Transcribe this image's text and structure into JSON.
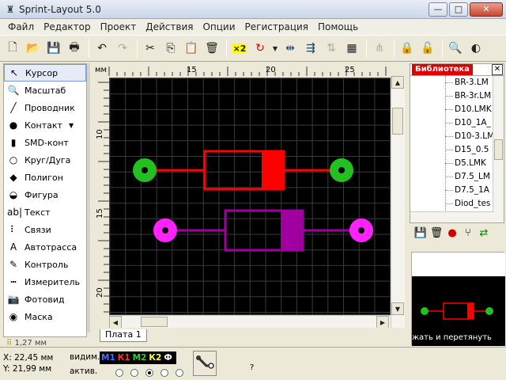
{
  "window": {
    "title": "Sprint-Layout 5.0",
    "min_label": "—",
    "max_label": "□",
    "close_label": "✕"
  },
  "menu": [
    "Файл",
    "Редактор",
    "Проект",
    "Действия",
    "Опции",
    "Регистрация",
    "Помощь"
  ],
  "toolbar": {
    "icons": [
      "new-icon",
      "open-icon",
      "save-icon",
      "print-icon",
      "undo-icon",
      "redo-icon",
      "cut-icon",
      "copy-icon",
      "paste-icon",
      "delete-icon",
      "x2-icon",
      "rotate-icon",
      "mirror-icon",
      "align-icon",
      "group-icon",
      "ungroup-icon",
      "connect-icon",
      "lock-icon",
      "unlock-icon",
      "zoom-icon",
      "contrast-icon"
    ],
    "x2_label": "×2"
  },
  "tools": [
    {
      "label": "Курсор",
      "icon": "cursor-icon",
      "glyph": "↖",
      "active": true
    },
    {
      "label": "Масштаб",
      "icon": "zoom-icon",
      "glyph": "🔍",
      "active": false
    },
    {
      "label": "Проводник",
      "icon": "track-icon",
      "glyph": "╱",
      "active": false
    },
    {
      "label": "Контакт",
      "icon": "pad-icon",
      "glyph": "●",
      "active": false,
      "dropdown": "▼"
    },
    {
      "label": "SMD-конт",
      "icon": "smd-icon",
      "glyph": "▮",
      "active": false
    },
    {
      "label": "Круг/Дуга",
      "icon": "circle-icon",
      "glyph": "○",
      "active": false
    },
    {
      "label": "Полигон",
      "icon": "polygon-icon",
      "glyph": "◆",
      "active": false
    },
    {
      "label": "Фигура",
      "icon": "shape-icon",
      "glyph": "◒",
      "active": false
    },
    {
      "label": "Текст",
      "icon": "text-icon",
      "glyph": "ab|",
      "active": false
    },
    {
      "label": "Связи",
      "icon": "connections-icon",
      "glyph": "⠇",
      "active": false
    },
    {
      "label": "Автотрасса",
      "icon": "autoroute-icon",
      "glyph": "A",
      "active": false
    },
    {
      "label": "Контроль",
      "icon": "check-icon",
      "glyph": "✎",
      "active": false
    },
    {
      "label": "Измеритель",
      "icon": "measure-icon",
      "glyph": "┅",
      "active": false
    },
    {
      "label": "Фотовид",
      "icon": "camera-icon",
      "glyph": "📷",
      "active": false
    },
    {
      "label": "Маска",
      "icon": "mask-icon",
      "glyph": "◉",
      "active": false
    }
  ],
  "grid_label": "1,27 мм",
  "ruler": {
    "unit": "мм",
    "top_ticks": [
      "15",
      "20",
      "25"
    ],
    "left_ticks": [
      "10",
      "15",
      "20"
    ]
  },
  "board_tab": "Плата 1",
  "library": {
    "title": "Библиотека",
    "close": "✕",
    "items": [
      "BR-3.LM",
      "BR-3r.LM",
      "D10.LMK",
      "D10_1A_",
      "D10-3.LM",
      "D15_0.5",
      "D5.LMK",
      "D7.5_LM",
      "D7.5_1A",
      "Diod_tes"
    ],
    "hint": "жать и перетянуть",
    "tool_icons": [
      "save-icon",
      "delete-icon",
      "record-icon",
      "filter-icon",
      "refresh-icon"
    ]
  },
  "status": {
    "x_label": "X:",
    "x_value": "22,45 мм",
    "y_label": "Y:",
    "y_value": "21,99 мм",
    "visible_label": "видим.",
    "active_label": "актив.",
    "layers": [
      {
        "name": "М1",
        "color": "#4a6bff"
      },
      {
        "name": "К1",
        "color": "#ff3030"
      },
      {
        "name": "М2",
        "color": "#30d030"
      },
      {
        "name": "К2",
        "color": "#ffff30"
      },
      {
        "name": "Ф",
        "color": "#ffffff"
      }
    ],
    "active_layer_index": 2,
    "help": "?"
  },
  "colors": {
    "canvas": "#000000",
    "grid": "#3a3a3a",
    "red": "#ff0000",
    "green": "#22c020",
    "magenta": "#ff22ff",
    "purple": "#a000a0"
  }
}
